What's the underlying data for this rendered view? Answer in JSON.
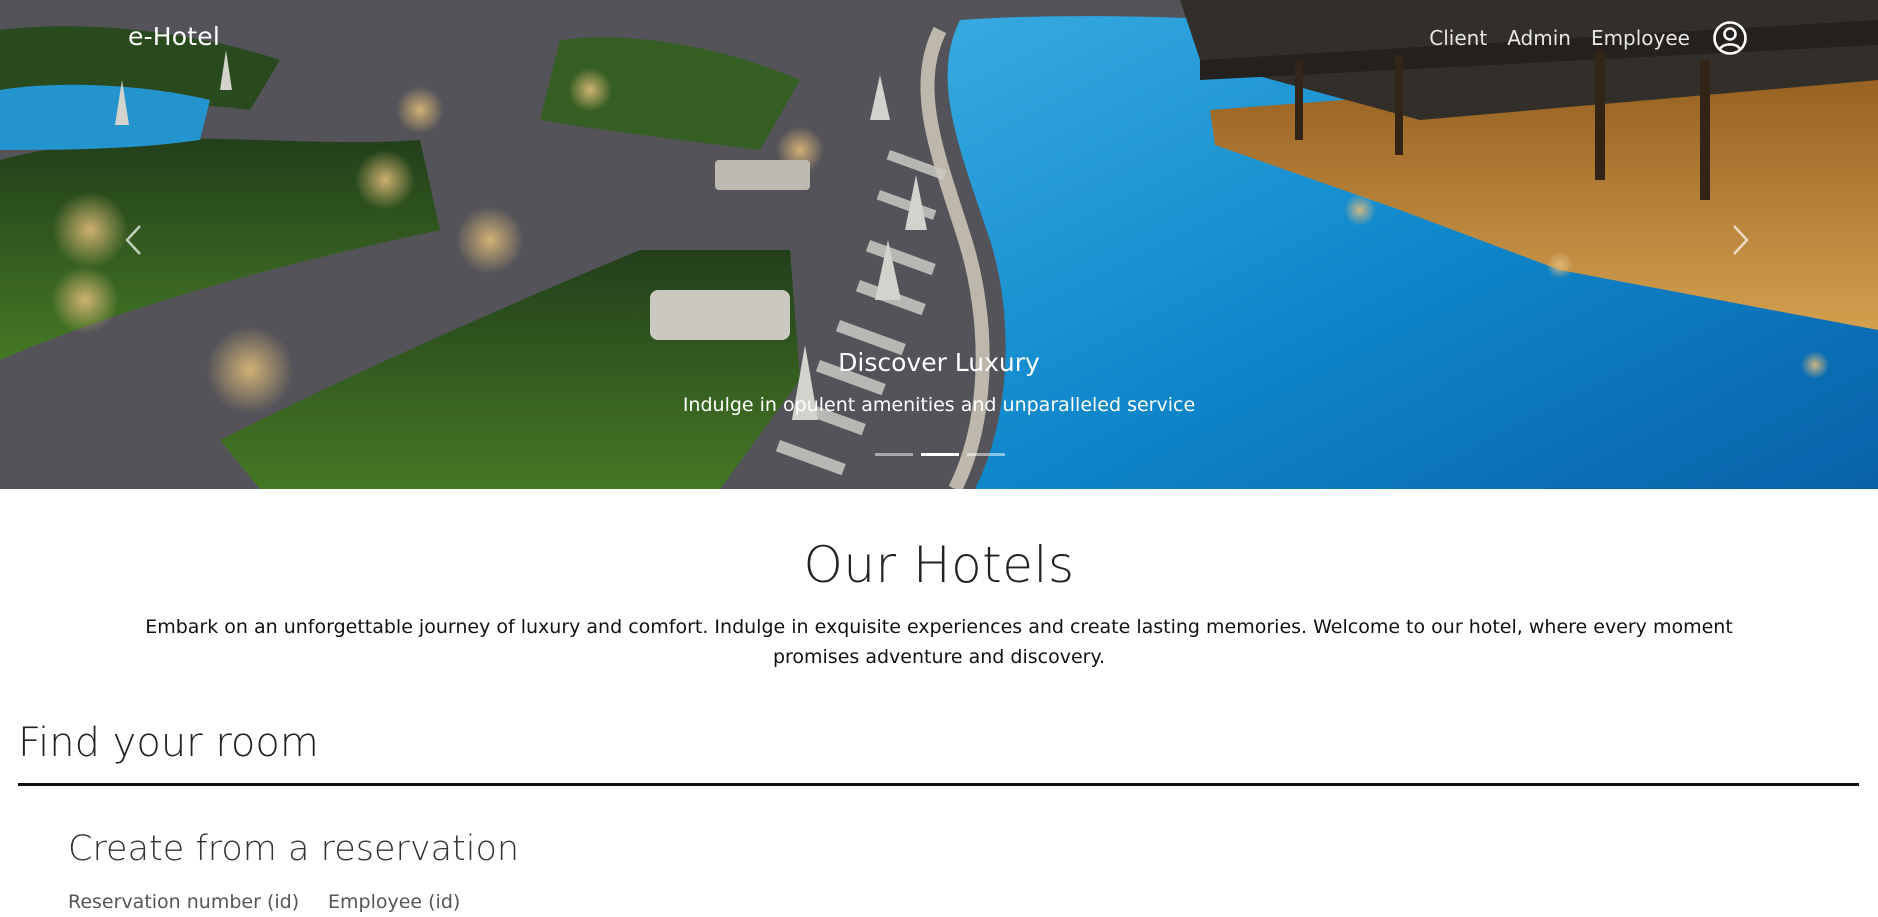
{
  "navbar": {
    "brand": "e-Hotel",
    "links": [
      "Client",
      "Admin",
      "Employee"
    ],
    "account_icon": "account-circle-icon"
  },
  "hero": {
    "caption_title": "Discover Luxury",
    "caption_text": "Indulge in opulent amenities and unparalleled service",
    "slide_count": 3,
    "active_slide": 2,
    "prev_icon": "chevron-left-icon",
    "next_icon": "chevron-right-icon"
  },
  "about": {
    "title": "Our Hotels",
    "text": "Embark on an unforgettable journey of luxury and comfort. Indulge in exquisite experiences and create lasting memories. Welcome to our hotel, where every moment promises adventure and discovery."
  },
  "find_room": {
    "title": "Find your room"
  },
  "reservation": {
    "title": "Create from a reservation",
    "reservation_label": "Reservation number (id)",
    "employee_label": "Employee (id)"
  },
  "colors": {
    "pool": "#1f9fe8",
    "deck_light": "#e8a34a",
    "lawn": "#2f5a22"
  }
}
